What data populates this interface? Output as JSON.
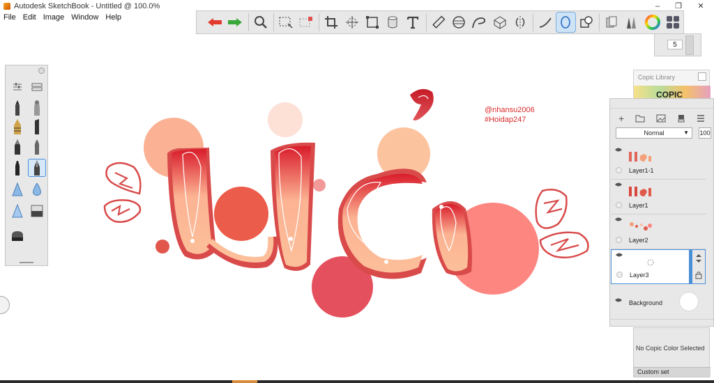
{
  "app": {
    "title": "Autodesk SketchBook - Untitled @ 100.0%",
    "window_controls": [
      "–",
      "❐",
      "✕"
    ]
  },
  "menu": [
    "File",
    "Edit",
    "Image",
    "Window",
    "Help"
  ],
  "toolbar": {
    "tools": [
      "undo-icon",
      "redo-icon",
      "zoom-icon",
      "rect-select-icon",
      "lasso-select-icon",
      "crop-icon",
      "transform-icon",
      "distort-icon",
      "bucket-icon",
      "text-icon",
      "ruler-icon",
      "ellipse-guide-icon",
      "french-curve-icon",
      "perspective-icon",
      "symmetry-icon",
      "stroke-icon",
      "ellipse-icon",
      "shape-icon",
      "layers-icon",
      "brush-library-icon",
      "color-wheel-icon",
      "copic-icon"
    ],
    "active_tool": "ellipse-icon"
  },
  "brush_size": {
    "value": "5"
  },
  "brushes": {
    "items": [
      "pencil",
      "airbrush",
      "ballpoint",
      "chisel-marker",
      "ink-pen",
      "brush-pen",
      "marker",
      "fineliner-pen",
      "smudge",
      "water-drop",
      "triangle-smudge",
      "eraser-block",
      "eraser"
    ],
    "active": "fineliner-pen"
  },
  "canvas": {
    "watermark_line1": "@nhansu2006",
    "watermark_line2": "#Hoidap247"
  },
  "copic_library": {
    "title": "Copic Library",
    "logo": "COPIC"
  },
  "layers": {
    "blend_mode": "Normal",
    "opacity": "100",
    "rows": [
      {
        "name": "Layer1-1",
        "selected": false
      },
      {
        "name": "Layer1",
        "selected": false
      },
      {
        "name": "Layer2",
        "selected": false
      },
      {
        "name": "Layer3",
        "selected": true
      }
    ],
    "background_label": "Background"
  },
  "copic_panel": {
    "message": "No Copic Color Selected",
    "set_label": "Custom set"
  }
}
